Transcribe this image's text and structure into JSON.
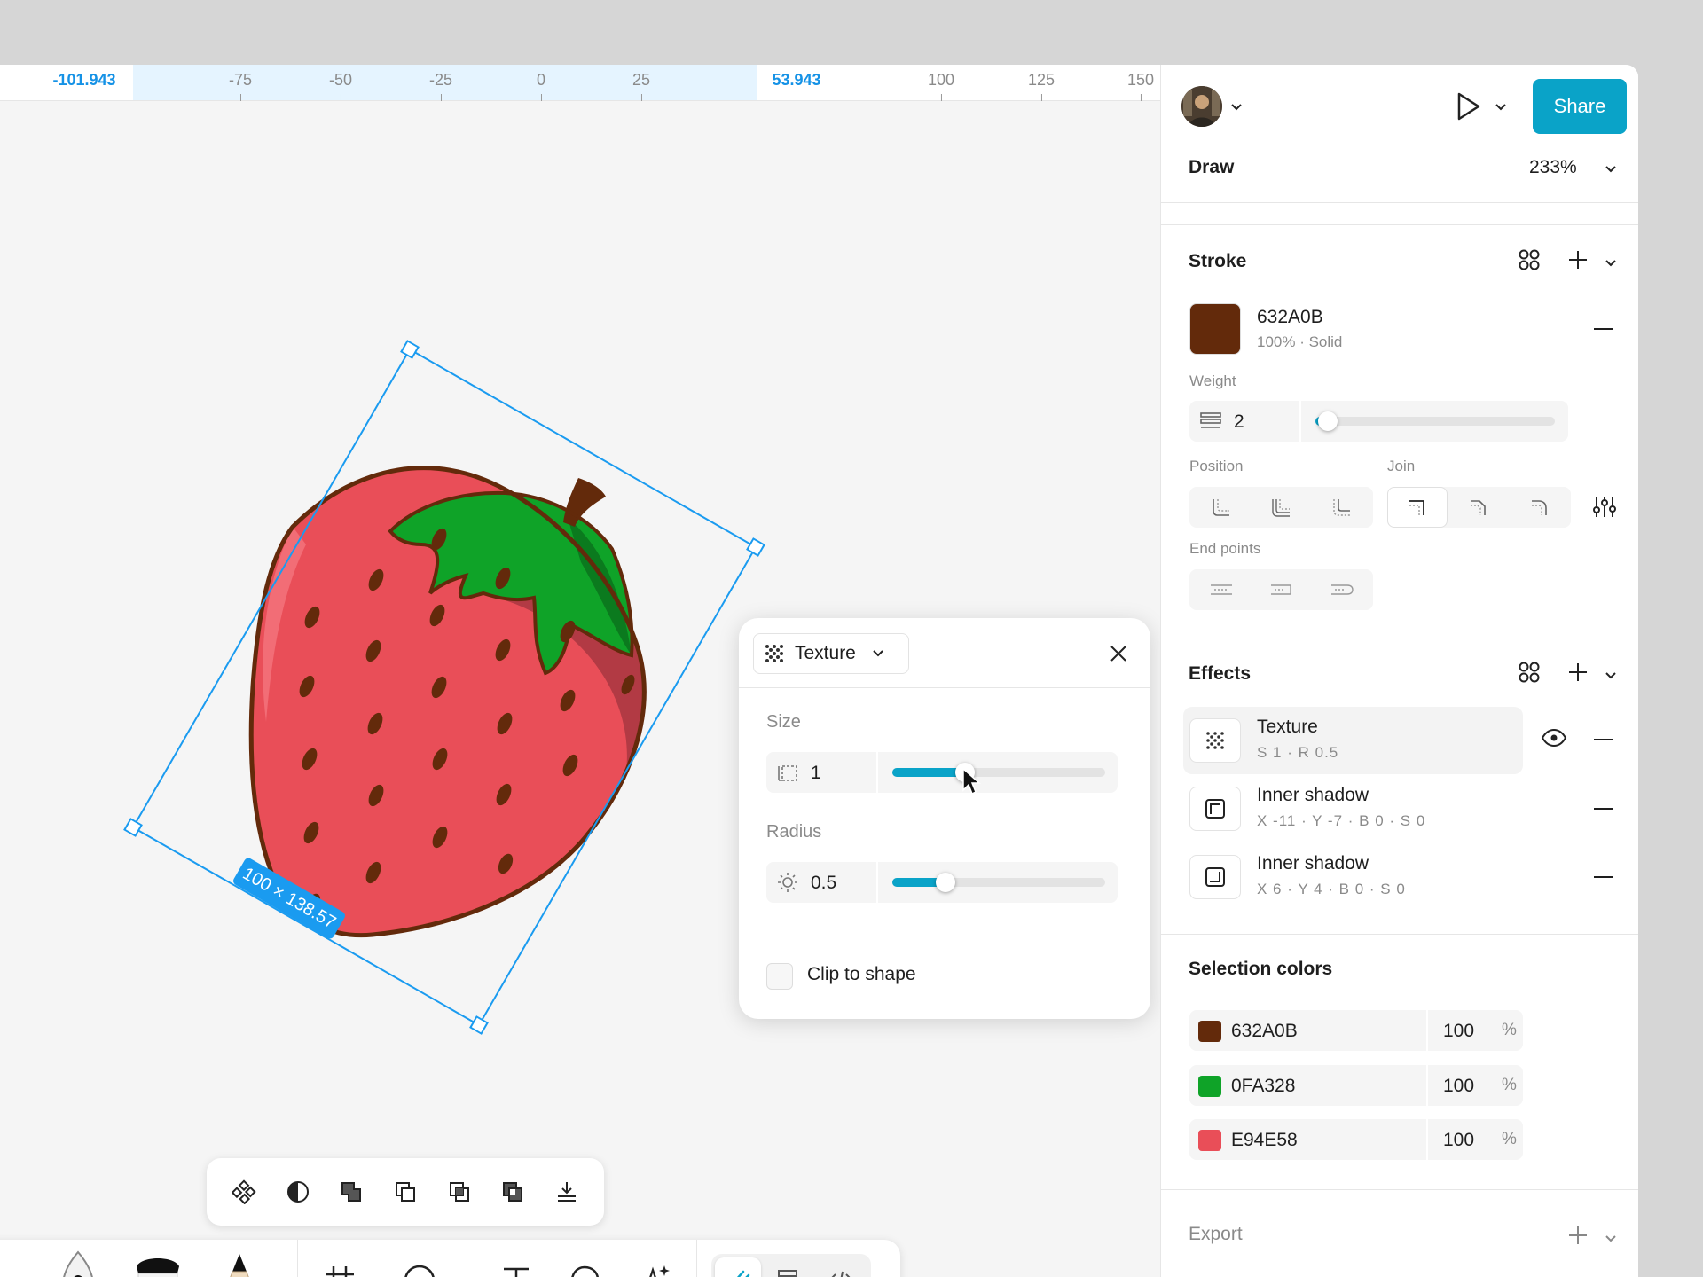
{
  "ruler": {
    "left_value": "-101.943",
    "right_value": "53.943",
    "ticks": [
      "-75",
      "-50",
      "-25",
      "0",
      "25",
      "100",
      "125",
      "150"
    ]
  },
  "canvas": {
    "dimension_label": "100 × 138.57"
  },
  "texture_popover": {
    "effect_type": "Texture",
    "size_label": "Size",
    "size_value": "1",
    "size_slider_fraction": 0.34,
    "radius_label": "Radius",
    "radius_value": "0.5",
    "radius_slider_fraction": 0.25,
    "clip_label": "Clip to shape"
  },
  "header": {
    "share_label": "Share",
    "mode_label": "Draw",
    "zoom": "233%"
  },
  "stroke": {
    "title": "Stroke",
    "color_hex": "632A0B",
    "color_swatch": "#632A0B",
    "color_meta": "100% · Solid",
    "weight_label": "Weight",
    "weight_value": "2",
    "weight_slider_fraction": 0.05,
    "position_label": "Position",
    "join_label": "Join",
    "endpoints_label": "End points"
  },
  "effects": {
    "title": "Effects",
    "items": [
      {
        "name": "Texture",
        "detail": "S 1 · R 0.5"
      },
      {
        "name": "Inner shadow",
        "detail": "X -11 · Y -7 · B 0 · S 0"
      },
      {
        "name": "Inner shadow",
        "detail": "X 6 · Y 4 · B 0 · S 0"
      }
    ]
  },
  "selection_colors": {
    "title": "Selection colors",
    "items": [
      {
        "hex": "632A0B",
        "swatch": "#632A0B",
        "opacity": "100",
        "unit": "%"
      },
      {
        "hex": "0FA328",
        "swatch": "#0FA328",
        "opacity": "100",
        "unit": "%"
      },
      {
        "hex": "E94E58",
        "swatch": "#E94E58",
        "opacity": "100",
        "unit": "%"
      }
    ]
  },
  "export": {
    "title": "Export"
  },
  "colors": {
    "accent": "#0aa3c8",
    "selection_blue": "#1a9bf0"
  }
}
